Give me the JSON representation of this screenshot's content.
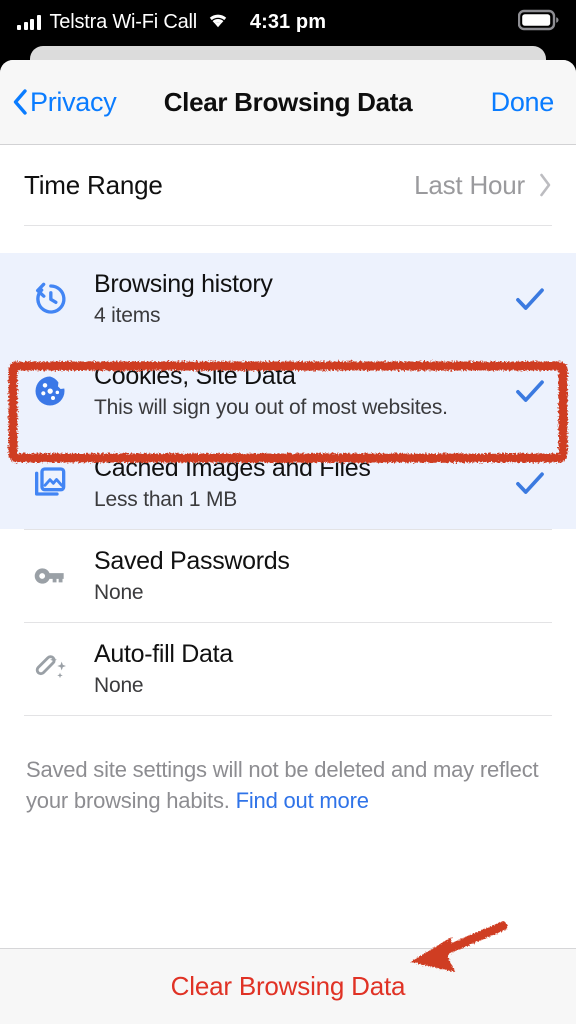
{
  "status_bar": {
    "carrier": "Telstra Wi-Fi Call",
    "time": "4:31 pm",
    "signal_icon": "cellular-bars-icon",
    "wifi_icon": "wifi-icon",
    "battery_icon": "battery-icon"
  },
  "nav": {
    "back_label": "Privacy",
    "back_icon": "chevron-left-icon",
    "title": "Clear Browsing Data",
    "done_label": "Done"
  },
  "time_range": {
    "label": "Time Range",
    "value": "Last Hour",
    "chevron_icon": "chevron-right-icon"
  },
  "items": [
    {
      "title": "Browsing history",
      "subtitle": "4 items",
      "icon": "history-clock-icon",
      "selected": true,
      "check_icon": "checkmark-icon"
    },
    {
      "title": "Cookies, Site Data",
      "subtitle": "This will sign you out of most websites.",
      "icon": "cookie-icon",
      "selected": true,
      "check_icon": "checkmark-icon"
    },
    {
      "title": "Cached Images and Files",
      "subtitle": "Less than 1 MB",
      "icon": "photo-stack-icon",
      "selected": true,
      "check_icon": "checkmark-icon"
    },
    {
      "title": "Saved Passwords",
      "subtitle": "None",
      "icon": "key-icon",
      "selected": false,
      "check_icon": ""
    },
    {
      "title": "Auto-fill Data",
      "subtitle": "None",
      "icon": "magic-wand-icon",
      "selected": false,
      "check_icon": ""
    }
  ],
  "footnote": {
    "text": "Saved site settings will not be deleted and may reflect your browsing habits.",
    "link": "Find out more"
  },
  "bottom_action": {
    "label": "Clear Browsing Data"
  },
  "annotations": {
    "highlight_box": "red-highlight-rectangle",
    "arrow": "red-arrow-pointing-to-clear-button",
    "color": "#cf3c24"
  },
  "colors": {
    "accent_blue": "#0a7cff",
    "check_blue": "#3b7ae0",
    "selected_row_bg": "#edf2fd",
    "destructive_red": "#e03225",
    "annotation_red": "#cf3c24"
  }
}
